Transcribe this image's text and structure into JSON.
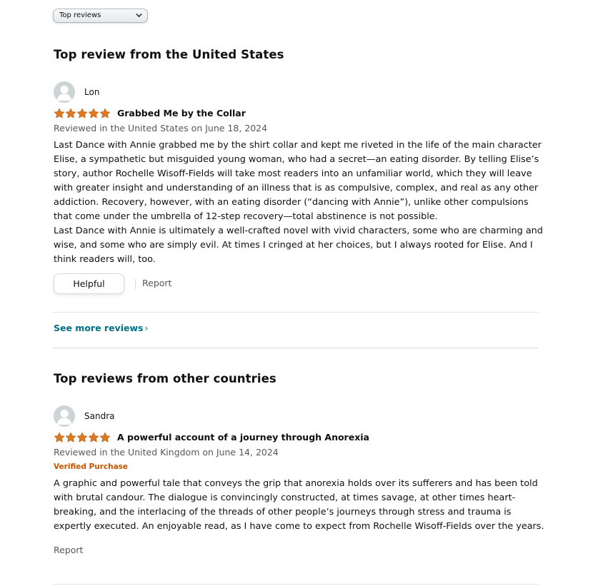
{
  "sort": {
    "selected": "Top reviews"
  },
  "sections": [
    {
      "title": "Top review from the United States"
    },
    {
      "title": "Top reviews from other countries"
    }
  ],
  "reviews": [
    {
      "author": "Lon",
      "rating": 5,
      "title": "Grabbed Me by the Collar",
      "date_line": "Reviewed in the United States on June 18, 2024",
      "body": [
        "Last Dance with Annie grabbed me by the shirt collar and kept me riveted in the life of the main character Elise, a sympathetic but misguided young woman, who had a secret—an eating disorder. By telling Elise’s story, author Rochelle Wisoff-Fields will take most readers into an unfamiliar world, which they will leave with greater insight and understanding of an illness that is as compulsive, complex, and real as any other addiction. Recovery, however, with an eating disorder (“dancing with Annie”), unlike other compulsions that come under the umbrella of 12-step recovery—total abstinence is not possible.",
        "Last Dance with Annie is ultimately a well-crafted novel with vivid characters, some who are charming and wise, and some who are simply evil. At times I cringed at her choices, but I always rooted for Elise. And I think readers will, too."
      ],
      "helpful_label": "Helpful",
      "report_label": "Report"
    },
    {
      "author": "Sandra",
      "rating": 5,
      "title": "A powerful account of a journey through Anorexia",
      "date_line": "Reviewed in the United Kingdom on June 14, 2024",
      "badge": "Verified Purchase",
      "body": [
        "A graphic and powerful tale that conveys the grip that anorexia holds over its sufferers and has been told with brutal candour. The dialogue is convincingly constructed, at times savage, at other times heart-breaking, and the interlacing of the threads of other people’s journeys through stress and trauma is expertly executed. An enjoyable read, as I have come to expect from Rochelle Wisoff-Fields over the years."
      ],
      "report_label": "Report"
    }
  ],
  "see_more": {
    "label": "See more reviews",
    "chevron": "›"
  },
  "colors": {
    "star": "#de7921",
    "link": "#007185",
    "verified": "#c45500",
    "secondary_text": "#565959"
  },
  "icons": {
    "sort_chevron": "chevron-down-icon",
    "avatar": "default-avatar-icon",
    "star": "star-icon"
  }
}
